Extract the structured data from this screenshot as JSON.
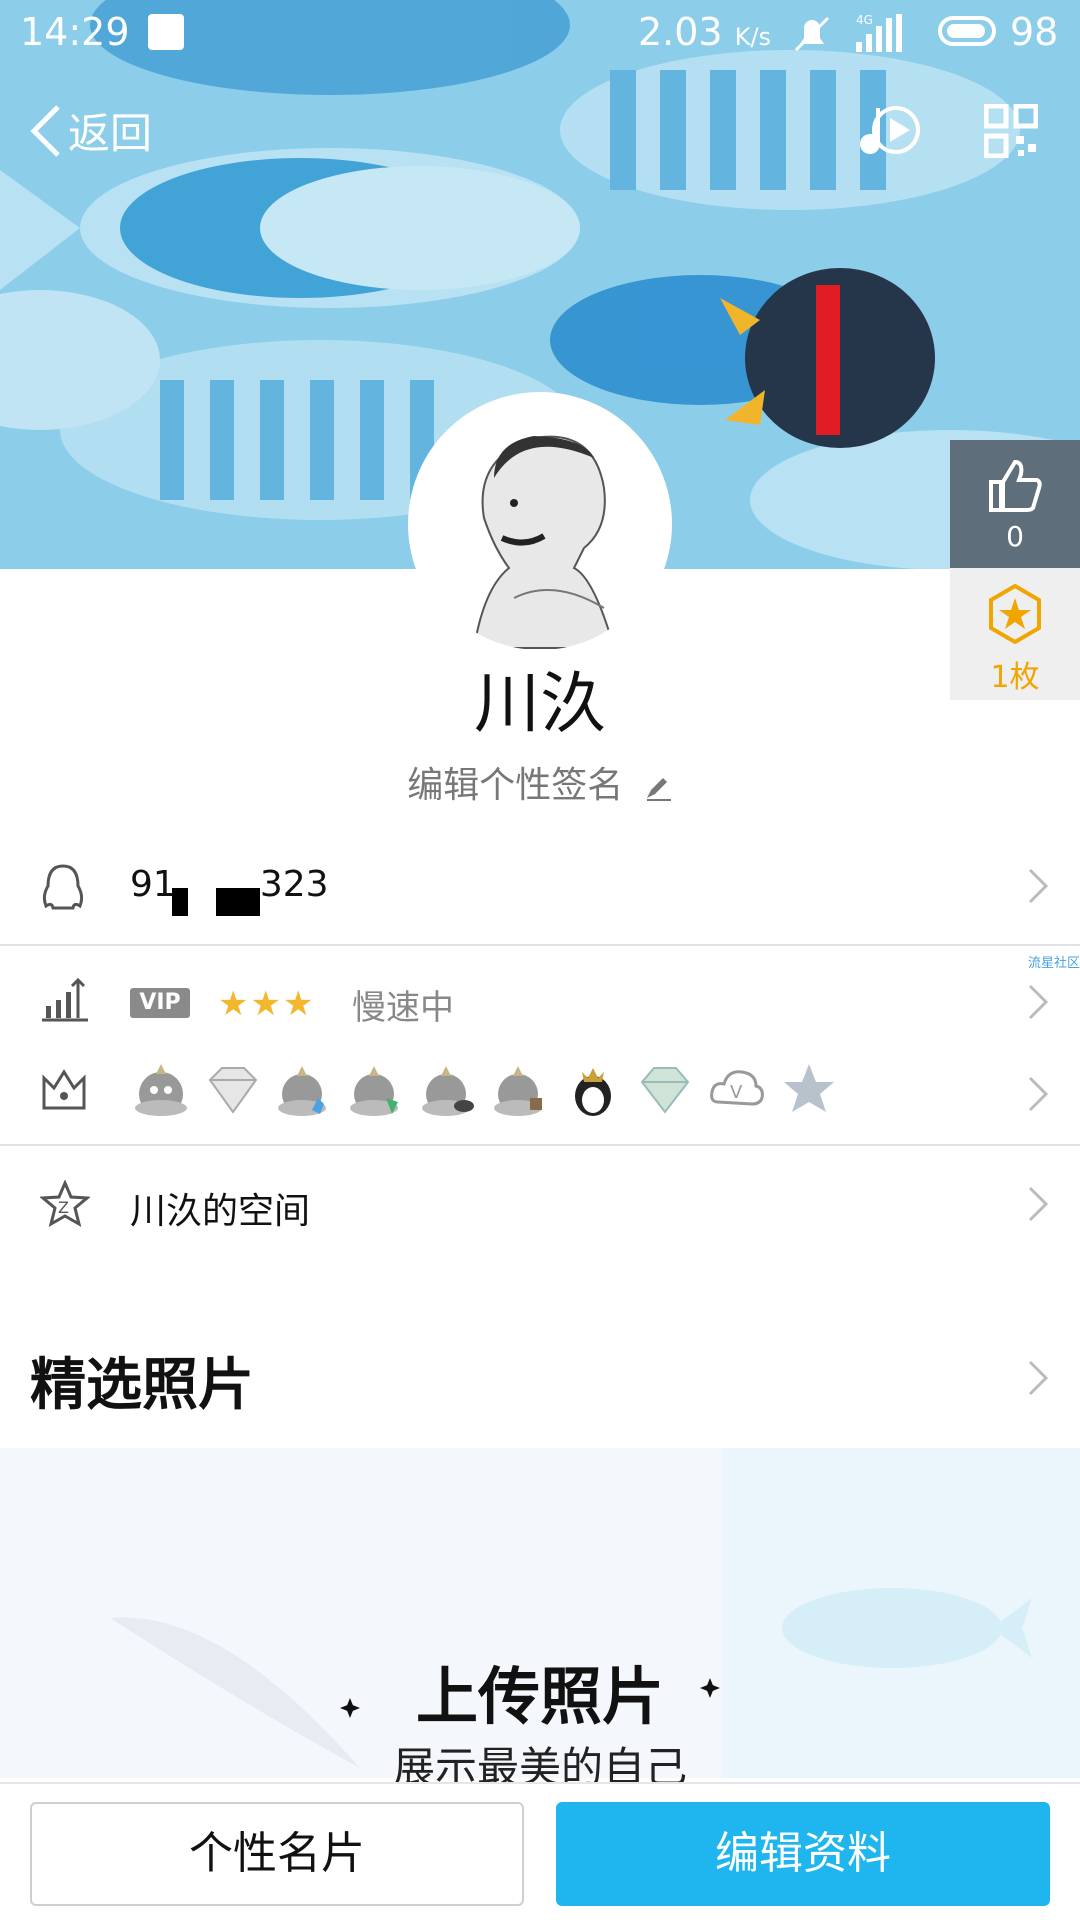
{
  "status_bar": {
    "time": "14:29",
    "news_icon": "news-icon",
    "net_speed": "2.03",
    "net_speed_unit": "K/s",
    "network": "4G",
    "battery": "98"
  },
  "nav": {
    "back_label": "返回",
    "music_icon": "music-play-icon",
    "qr_icon": "qr-code-icon"
  },
  "side": {
    "likes": "0",
    "medals": "1枚"
  },
  "profile": {
    "nickname": "川汣",
    "signature": "编辑个性签名"
  },
  "account": {
    "qq_prefix": "91",
    "qq_suffix": "323"
  },
  "vip": {
    "badge": "VIP",
    "stars": "★★★",
    "status": "慢速中",
    "watermark": "流星社区"
  },
  "space": {
    "label": "川汣的空间"
  },
  "photos": {
    "title": "精选照片",
    "upload_title": "上传照片",
    "upload_sub": "展示最美的自己"
  },
  "actions": {
    "card": "个性名片",
    "edit": "编辑资料"
  },
  "colors": {
    "accent": "#1fb6f0",
    "cover": "#8fd0ec",
    "star": "#f2b72a"
  }
}
